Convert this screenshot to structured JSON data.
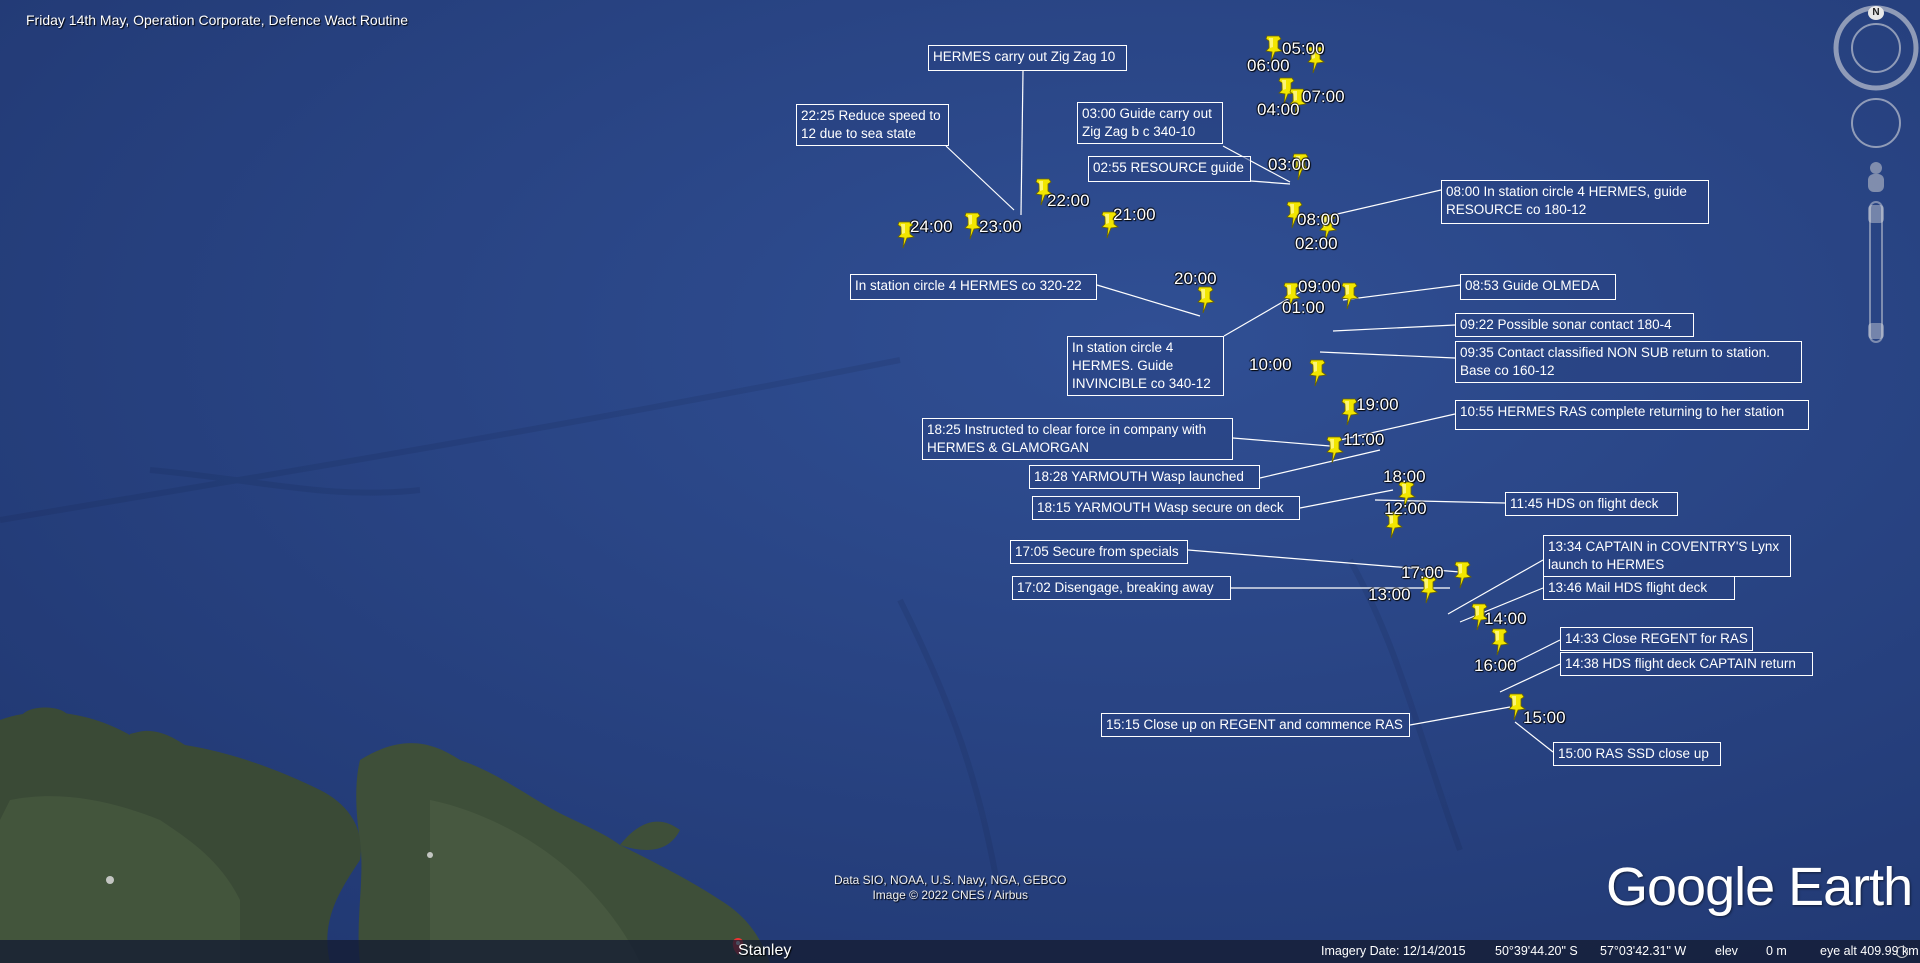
{
  "title": "Friday 14th May, Operation Corporate, Defence Wact Routine",
  "callouts": [
    {
      "text": "HERMES carry out Zig Zag 10"
    },
    {
      "text": "22:25 Reduce speed to\n12 due to sea state"
    },
    {
      "text": "03:00 Guide carry out\nZig Zag b c 340-10"
    },
    {
      "text": "02:55 RESOURCE guide"
    },
    {
      "text": "08:00 In station circle 4 HERMES, guide\nRESOURCE co 180-12"
    },
    {
      "text": "In station circle 4 HERMES co 320-22"
    },
    {
      "text": "08:53 Guide OLMEDA"
    },
    {
      "text": "09:22 Possible sonar contact 180-4"
    },
    {
      "text": "09:35 Contact classified NON SUB return to station.\nBase co 160-12"
    },
    {
      "text": "In station circle 4\nHERMES. Guide\nINVINCIBLE co 340-12"
    },
    {
      "text": "10:55 HERMES RAS complete returning to her station"
    },
    {
      "text": "18:25 Instructed to clear force in company with\nHERMES & GLAMORGAN"
    },
    {
      "text": "18:28 YARMOUTH Wasp launched"
    },
    {
      "text": "18:15 YARMOUTH Wasp secure on deck"
    },
    {
      "text": "11:45 HDS on flight deck"
    },
    {
      "text": "17:05 Secure from specials"
    },
    {
      "text": "13:34 CAPTAIN in COVENTRY'S Lynx\nlaunch to HERMES"
    },
    {
      "text": "17:02 Disengage, breaking away"
    },
    {
      "text": "13:46 Mail HDS flight deck"
    },
    {
      "text": "14:33 Close REGENT for RAS"
    },
    {
      "text": "14:38 HDS flight deck CAPTAIN return"
    },
    {
      "text": "15:15 Close up on REGENT and commence RAS"
    },
    {
      "text": "15:00 RAS SSD close up"
    }
  ],
  "time_labels": [
    "05:00",
    "06:00",
    "07:00",
    "04:00",
    "03:00",
    "22:00",
    "23:00",
    "24:00",
    "21:00",
    "08:00",
    "02:00",
    "20:00",
    "09:00",
    "01:00",
    "10:00",
    "19:00",
    "11:00",
    "18:00",
    "12:00",
    "17:00",
    "13:00",
    "14:00",
    "16:00",
    "15:00"
  ],
  "credits": {
    "line1": "Data SIO, NOAA, U.S. Navy, NGA, GEBCO",
    "line2": "Image © 2022 CNES / Airbus"
  },
  "logo": "Google Earth",
  "place_label": "Stanley",
  "compass_label": "N",
  "status": {
    "imagery_date": "Imagery Date: 12/14/2015",
    "lat": "50°39'44.20\" S",
    "lon": "57°03'42.31\" W",
    "elev_label": "elev",
    "elev_value": "0 m",
    "eye_alt": "eye alt 409.99 km"
  },
  "colors": {
    "ocean": "#2a4685",
    "land": "#3e4f3a",
    "pin": "#f2e600",
    "callout_border": "#ffffff"
  }
}
